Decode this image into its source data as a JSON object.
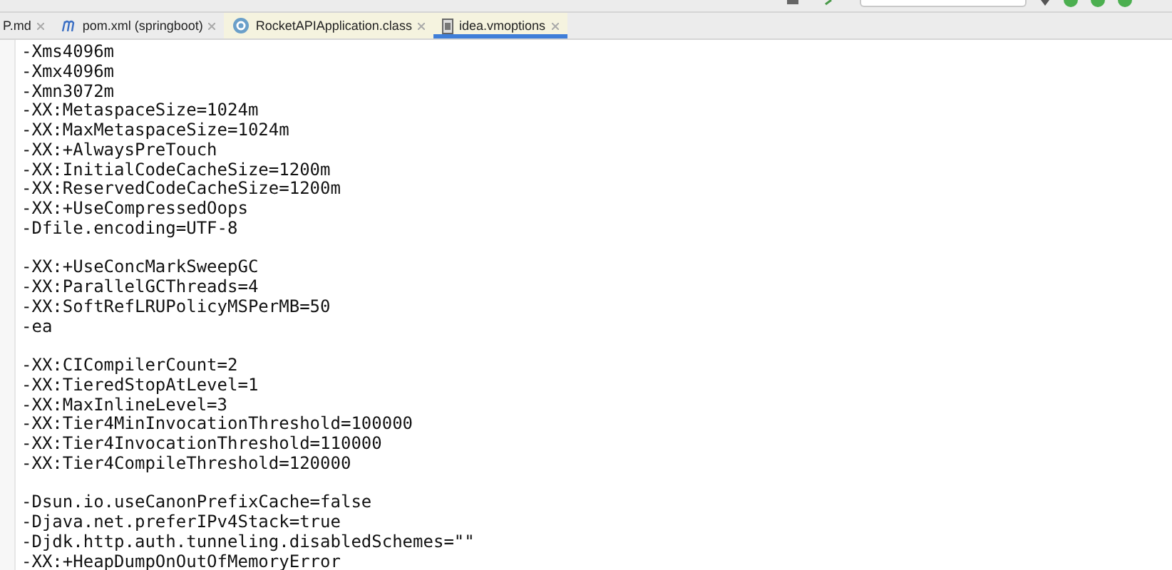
{
  "tabs": [
    {
      "label": "P.md",
      "kind": "markdown",
      "selected": false
    },
    {
      "label": "pom.xml (springboot)",
      "kind": "maven",
      "selected": false
    },
    {
      "label": "RocketAPIApplication.class",
      "kind": "class",
      "selected": false
    },
    {
      "label": "idea.vmoptions",
      "kind": "file",
      "selected": true
    }
  ],
  "editor": {
    "blocks": [
      [
        "-Xms4096m",
        "-Xmx4096m",
        "-Xmn3072m",
        "-XX:MetaspaceSize=1024m",
        "-XX:MaxMetaspaceSize=1024m",
        "-XX:+AlwaysPreTouch",
        "-XX:InitialCodeCacheSize=1200m",
        "-XX:ReservedCodeCacheSize=1200m",
        "-XX:+UseCompressedOops",
        "-Dfile.encoding=UTF-8"
      ],
      [
        "-XX:+UseConcMarkSweepGC",
        "-XX:ParallelGCThreads=4",
        "-XX:SoftRefLRUPolicyMSPerMB=50",
        "-ea"
      ],
      [
        "-XX:CICompilerCount=2",
        "-XX:TieredStopAtLevel=1",
        "-XX:MaxInlineLevel=3",
        "-XX:Tier4MinInvocationThreshold=100000",
        "-XX:Tier4InvocationThreshold=110000",
        "-XX:Tier4CompileThreshold=120000"
      ],
      [
        "-Dsun.io.useCanonPrefixCache=false",
        "-Djava.net.preferIPv4Stack=true",
        "-Djdk.http.auth.tunneling.disabledSchemes=\"\"",
        "-XX:+HeapDumpOnOutOfMemoryError"
      ]
    ]
  }
}
